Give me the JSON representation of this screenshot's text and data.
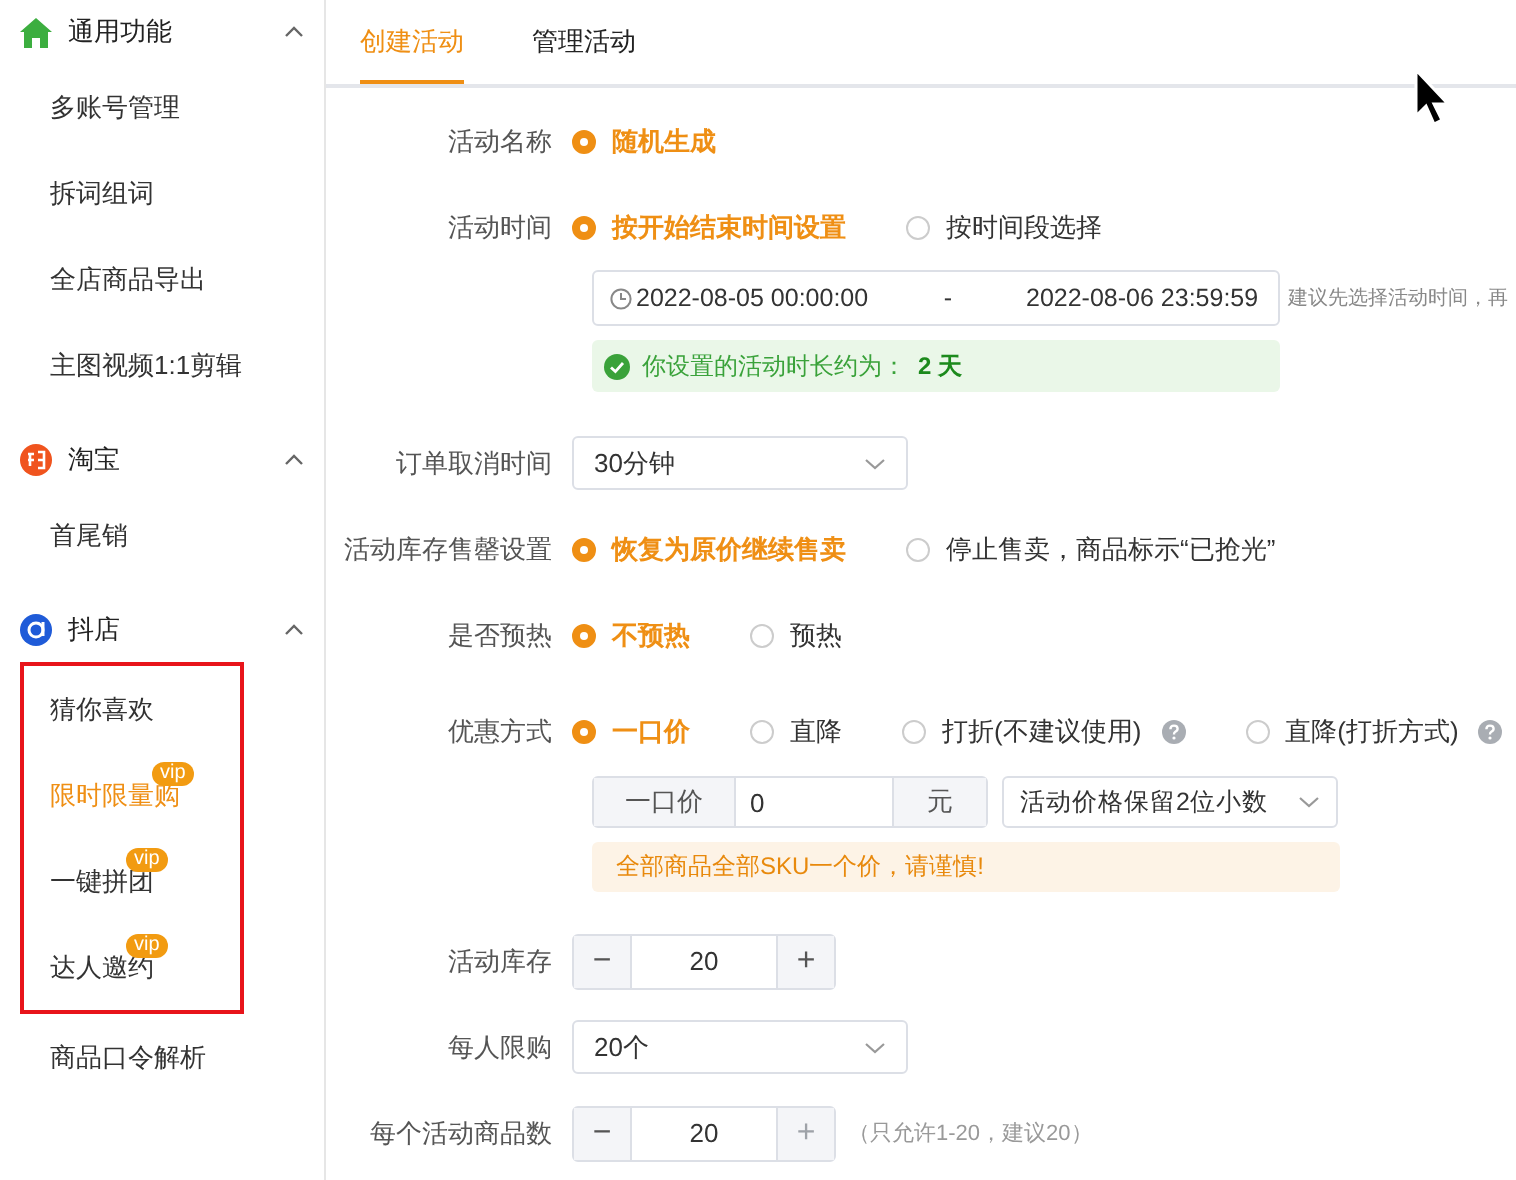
{
  "sidebar": {
    "sections": [
      {
        "title": "通用功能",
        "expanded": true,
        "items": [
          {
            "label": "多账号管理",
            "selected": false,
            "boxed": false
          },
          {
            "label": "拆词组词",
            "selected": false,
            "boxed": false
          },
          {
            "label": "全店商品导出",
            "selected": false,
            "boxed": false
          },
          {
            "label": "主图视频1:1剪辑",
            "selected": false,
            "boxed": false
          }
        ]
      },
      {
        "title": "淘宝",
        "expanded": true,
        "items": [
          {
            "label": "首尾销",
            "selected": false,
            "boxed": false
          }
        ]
      },
      {
        "title": "抖店",
        "expanded": true,
        "items": [
          {
            "label": "猜你喜欢",
            "selected": false,
            "boxed": true
          },
          {
            "label": "限时限量购",
            "selected": true,
            "badge": "vip",
            "boxed": true
          },
          {
            "label": "一键拼团",
            "selected": false,
            "badge": "vip",
            "boxed": true
          },
          {
            "label": "达人邀约",
            "selected": false,
            "badge": "vip",
            "boxed": true
          },
          {
            "label": "商品口令解析",
            "selected": false,
            "boxed": false
          }
        ]
      }
    ]
  },
  "tabs": [
    {
      "label": "创建活动",
      "selected": true
    },
    {
      "label": "管理活动",
      "selected": false
    }
  ],
  "form": {
    "rows": [
      {
        "kind": "radio",
        "label": "活动名称",
        "options": [
          {
            "label": "随机生成",
            "selected": true,
            "help": false
          }
        ]
      },
      {
        "kind": "radio",
        "label": "活动时间",
        "options": [
          {
            "label": "按开始结束时间设置",
            "selected": true,
            "help": false
          },
          {
            "label": "按时间段选择",
            "selected": false,
            "help": false
          }
        ]
      },
      {
        "kind": "date_range",
        "start": "2022-08-05 00:00:00",
        "separator": "-",
        "end": "2022-08-06 23:59:59",
        "hint": "建议先选择活动时间，再",
        "tip": "你设置的活动时长约为：**2 天**"
      },
      {
        "kind": "select",
        "label": "订单取消时间",
        "value": "30分钟"
      },
      {
        "kind": "radio",
        "label": "活动库存售罄设置",
        "options": [
          {
            "label": "恢复为原价继续售卖",
            "selected": true,
            "help": false
          },
          {
            "label": "停止售卖，商品标示“已抢光”",
            "selected": false,
            "help": false
          }
        ]
      },
      {
        "kind": "radio",
        "label": "是否预热",
        "options": [
          {
            "label": "不预热",
            "selected": true,
            "help": false
          },
          {
            "label": "预热",
            "selected": false,
            "help": false
          }
        ]
      },
      {
        "kind": "radio",
        "label": "优惠方式",
        "options": [
          {
            "label": "一口价",
            "selected": true,
            "help": false
          },
          {
            "label": "直降",
            "selected": false,
            "help": false
          },
          {
            "label": "打折(不建议使用)",
            "selected": false,
            "help": true
          },
          {
            "label": "直降(打折方式)",
            "selected": false,
            "help": true
          }
        ]
      },
      {
        "kind": "price",
        "prefix": "一口价",
        "value": "0",
        "suffix": "元",
        "select": "活动价格保留2位小数",
        "warning": "全部商品全部SKU一个价，请谨慎!"
      },
      {
        "kind": "stepper",
        "label": "活动库存",
        "value": "20",
        "minus": "−",
        "plus": "+",
        "plus_disabled": false
      },
      {
        "kind": "select",
        "label": "每人限购",
        "value": "20个"
      },
      {
        "kind": "stepper",
        "label": "每个活动商品数",
        "value": "20",
        "minus": "−",
        "plus": "+",
        "plus_disabled": true,
        "note": "（只允许1-20，建议20）"
      }
    ]
  }
}
